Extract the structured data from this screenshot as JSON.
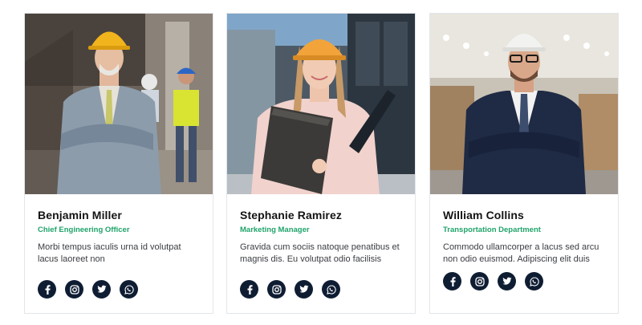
{
  "members": [
    {
      "name": "Benjamin Miller",
      "role": "Chief Engineering Officer",
      "description": "Morbi tempus iaculis urna id volutpat lacus laoreet non",
      "social": [
        "facebook-icon",
        "instagram-icon",
        "twitter-icon",
        "whatsapp-icon"
      ]
    },
    {
      "name": "Stephanie Ramirez",
      "role": "Marketing Manager",
      "description": "Gravida cum sociis natoque penatibus et magnis dis. Eu volutpat odio facilisis",
      "social": [
        "facebook-icon",
        "instagram-icon",
        "twitter-icon",
        "whatsapp-icon"
      ]
    },
    {
      "name": "William Collins",
      "role": "Transportation Department",
      "description": "Commodo ullamcorper a lacus sed arcu non odio euismod. Adipiscing elit duis",
      "social": [
        "facebook-icon",
        "instagram-icon",
        "twitter-icon",
        "whatsapp-icon"
      ]
    }
  ],
  "colors": {
    "accent": "#1fa36a",
    "icon_circle": "#0f1d33",
    "name_text": "#141414",
    "body_text": "#3a3d42",
    "card_border": "#e3e6ea"
  }
}
